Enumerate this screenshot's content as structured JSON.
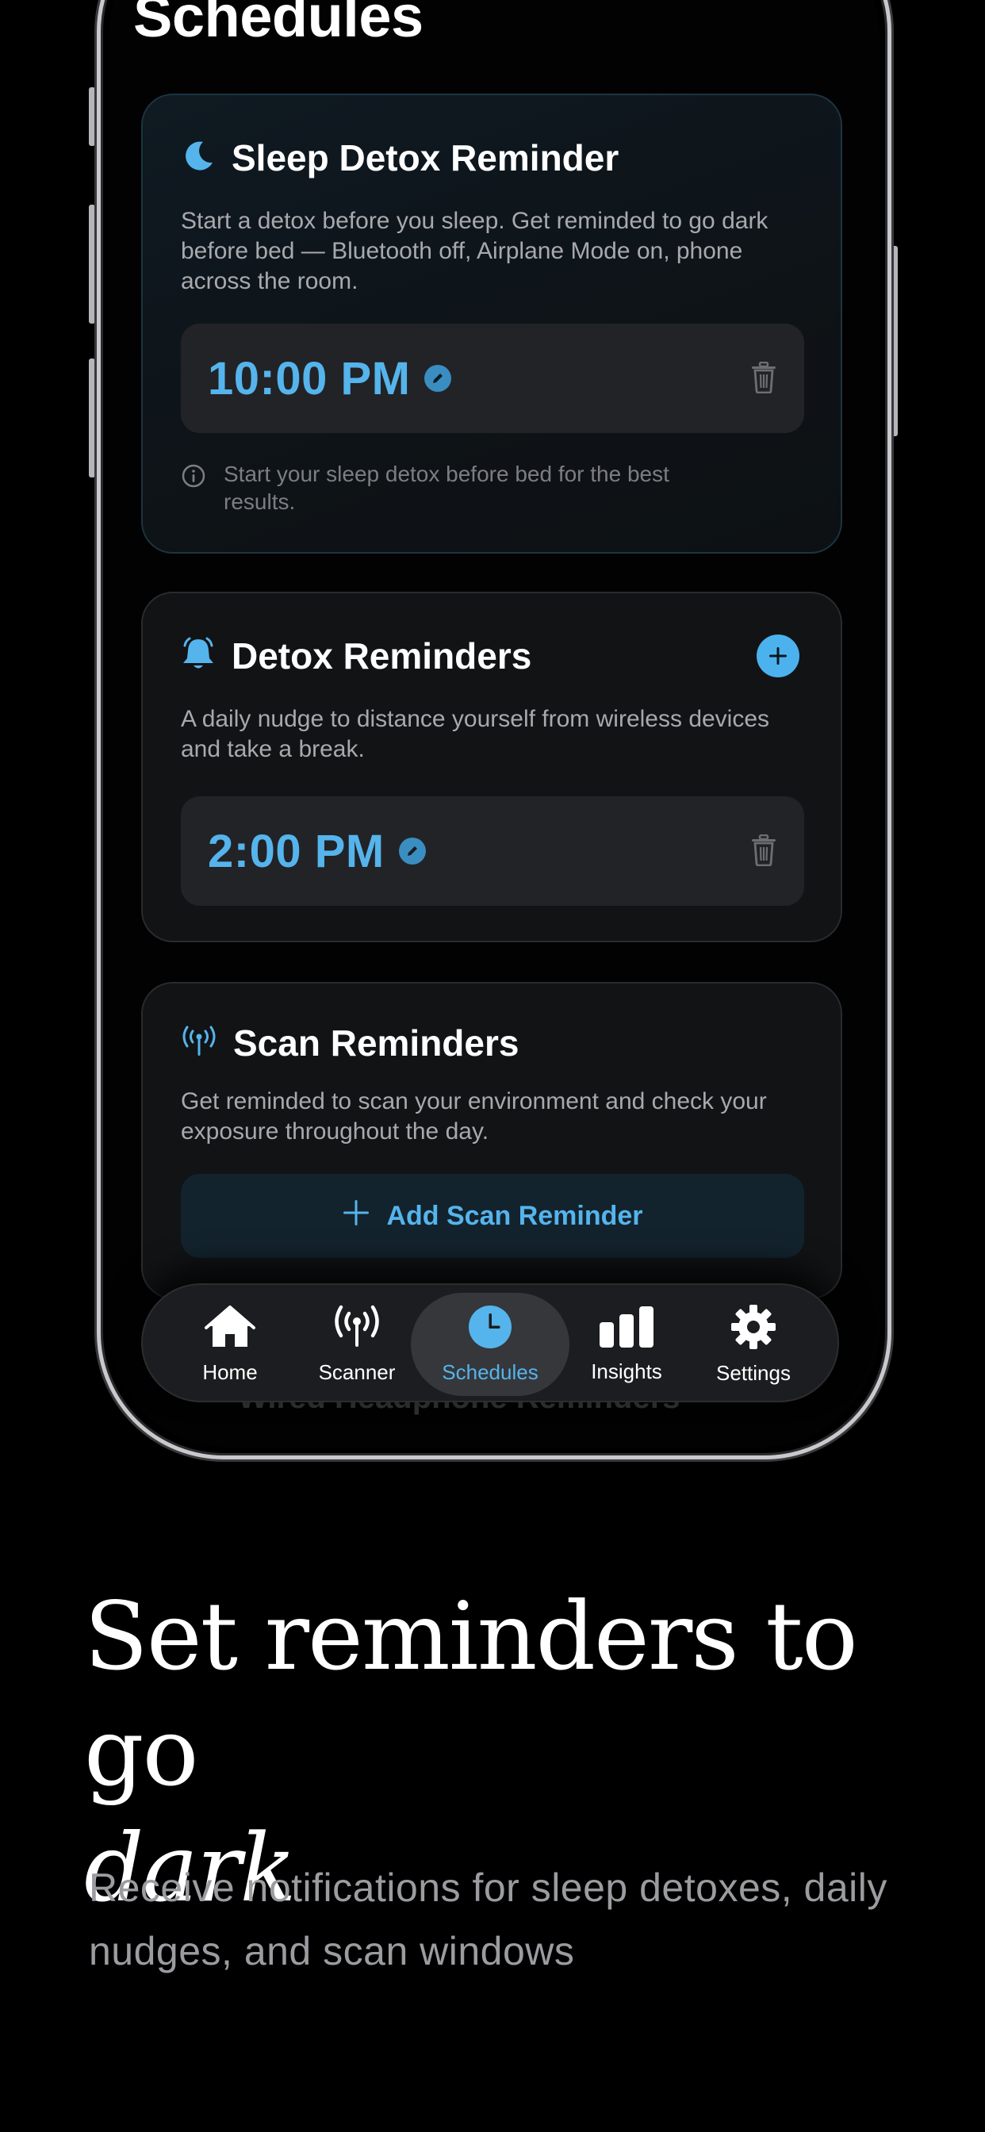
{
  "screen": {
    "title": "Schedules"
  },
  "sleep_card": {
    "title": "Sleep Detox Reminder",
    "description": "Start a detox before you sleep. Get reminded to go dark before bed — Bluetooth off, Airplane Mode on, phone across the room.",
    "time": "10:00 PM",
    "hint": "Start your sleep detox before bed for the best results.",
    "icon": "moon-icon"
  },
  "detox_card": {
    "title": "Detox Reminders",
    "description": "A daily nudge to distance yourself from wireless devices and take a break.",
    "time": "2:00 PM",
    "icon": "bell-icon"
  },
  "scan_card": {
    "title": "Scan Reminders",
    "description": "Get reminded to scan your environment and check your exposure throughout the day.",
    "add_button_label": "Add Scan Reminder",
    "icon": "antenna-icon"
  },
  "hidden_card": {
    "title": "Wired Headphone Reminders"
  },
  "tab_bar": {
    "tabs": [
      {
        "label": "Home",
        "icon": "home-icon"
      },
      {
        "label": "Scanner",
        "icon": "antenna-icon"
      },
      {
        "label": "Schedules",
        "icon": "clock-icon",
        "active": true
      },
      {
        "label": "Insights",
        "icon": "bar-chart-icon"
      },
      {
        "label": "Settings",
        "icon": "gear-icon"
      }
    ]
  },
  "marketing": {
    "headline": "Set reminders to go",
    "headline_italic": "dark",
    "subhead": "Receive notifications for sleep detoxes, daily nudges, and scan windows"
  },
  "colors": {
    "accent": "#55b4ec",
    "background": "#000000",
    "card": "#121315"
  }
}
